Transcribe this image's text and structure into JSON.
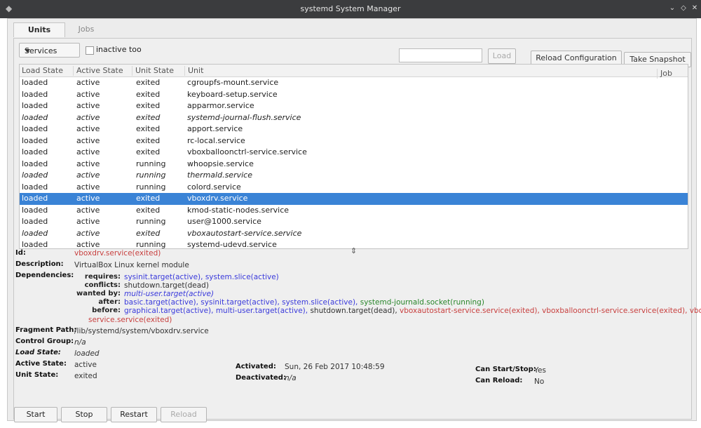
{
  "window": {
    "title": "systemd System Manager"
  },
  "tabs": [
    {
      "label": "Units"
    },
    {
      "label": "Jobs"
    }
  ],
  "toolbar": {
    "filter_select": "Services",
    "inactive_label": "inactive too",
    "search_value": "",
    "load_label": "Load",
    "reload_config_label": "Reload Configuration",
    "snapshot_label": "Take Snapshot"
  },
  "table": {
    "headers": [
      "Load State",
      "Active State",
      "Unit State",
      "Unit",
      "Job"
    ],
    "rows": [
      {
        "load": "loaded",
        "active": "active",
        "unit_state": "exited",
        "unit": "cgroupfs-mount.service"
      },
      {
        "load": "loaded",
        "active": "active",
        "unit_state": "exited",
        "unit": "keyboard-setup.service"
      },
      {
        "load": "loaded",
        "active": "active",
        "unit_state": "exited",
        "unit": "apparmor.service"
      },
      {
        "load": "loaded",
        "active": "active",
        "unit_state": "exited",
        "unit": "systemd-journal-flush.service"
      },
      {
        "load": "loaded",
        "active": "active",
        "unit_state": "exited",
        "unit": "apport.service"
      },
      {
        "load": "loaded",
        "active": "active",
        "unit_state": "exited",
        "unit": "rc-local.service"
      },
      {
        "load": "loaded",
        "active": "active",
        "unit_state": "exited",
        "unit": "vboxballoonctrl-service.service"
      },
      {
        "load": "loaded",
        "active": "active",
        "unit_state": "running",
        "unit": "whoopsie.service"
      },
      {
        "load": "loaded",
        "active": "active",
        "unit_state": "running",
        "unit": "thermald.service"
      },
      {
        "load": "loaded",
        "active": "active",
        "unit_state": "running",
        "unit": "colord.service"
      },
      {
        "load": "loaded",
        "active": "active",
        "unit_state": "exited",
        "unit": "vboxdrv.service"
      },
      {
        "load": "loaded",
        "active": "active",
        "unit_state": "exited",
        "unit": "kmod-static-nodes.service"
      },
      {
        "load": "loaded",
        "active": "active",
        "unit_state": "running",
        "unit": "user@1000.service"
      },
      {
        "load": "loaded",
        "active": "active",
        "unit_state": "exited",
        "unit": "vboxautostart-service.service"
      },
      {
        "load": "loaded",
        "active": "active",
        "unit_state": "running",
        "unit": "systemd-udevd.service"
      }
    ]
  },
  "details": {
    "id_label": "Id:",
    "id_value": "vboxdrv.service(exited)",
    "description_label": "Description:",
    "description_value": "VirtualBox Linux kernel module",
    "dependencies_label": "Dependencies:",
    "requires_key": "requires:",
    "requires_1": "sysinit.target(active), ",
    "requires_2": "system.slice(active)",
    "conflicts_key": "conflicts:",
    "conflicts_1": "shutdown.target(dead)",
    "wanted_key": "wanted by:",
    "wanted_1": "multi-user.target(active)",
    "after_key": "after:",
    "after_1": "basic.target(active), sysinit.target(active), system.slice(active), ",
    "after_2": "systemd-journald.socket(running)",
    "before_key": "before:",
    "before_1": "graphical.target(active), multi-user.target(active), ",
    "before_2": "shutdown.target(dead), ",
    "before_3": "vboxautostart-service.service(exited), vboxballoonctrl-service.service(exited), vboxweb-",
    "before_4": "service.service(exited)",
    "fragment_label": "Fragment Path:",
    "fragment_value": "/lib/systemd/system/vboxdrv.service",
    "cgroup_label": "Control Group:",
    "cgroup_value": "n/a",
    "load_state_label": "Load State:",
    "load_state_value": "loaded",
    "active_state_label": "Active State:",
    "active_state_value": "active",
    "unit_state_label": "Unit State:",
    "unit_state_value": "exited",
    "activated_label": "Activated:",
    "activated_value": "Sun, 26 Feb 2017 10:48:59",
    "deactivated_label": "Deactivated:",
    "deactivated_value": "n/a",
    "can_start_label": "Can Start/Stop:",
    "can_start_value": "Yes",
    "can_reload_label": "Can Reload:",
    "can_reload_value": "No"
  },
  "buttons": {
    "start": "Start",
    "stop": "Stop",
    "restart": "Restart",
    "reload": "Reload"
  }
}
